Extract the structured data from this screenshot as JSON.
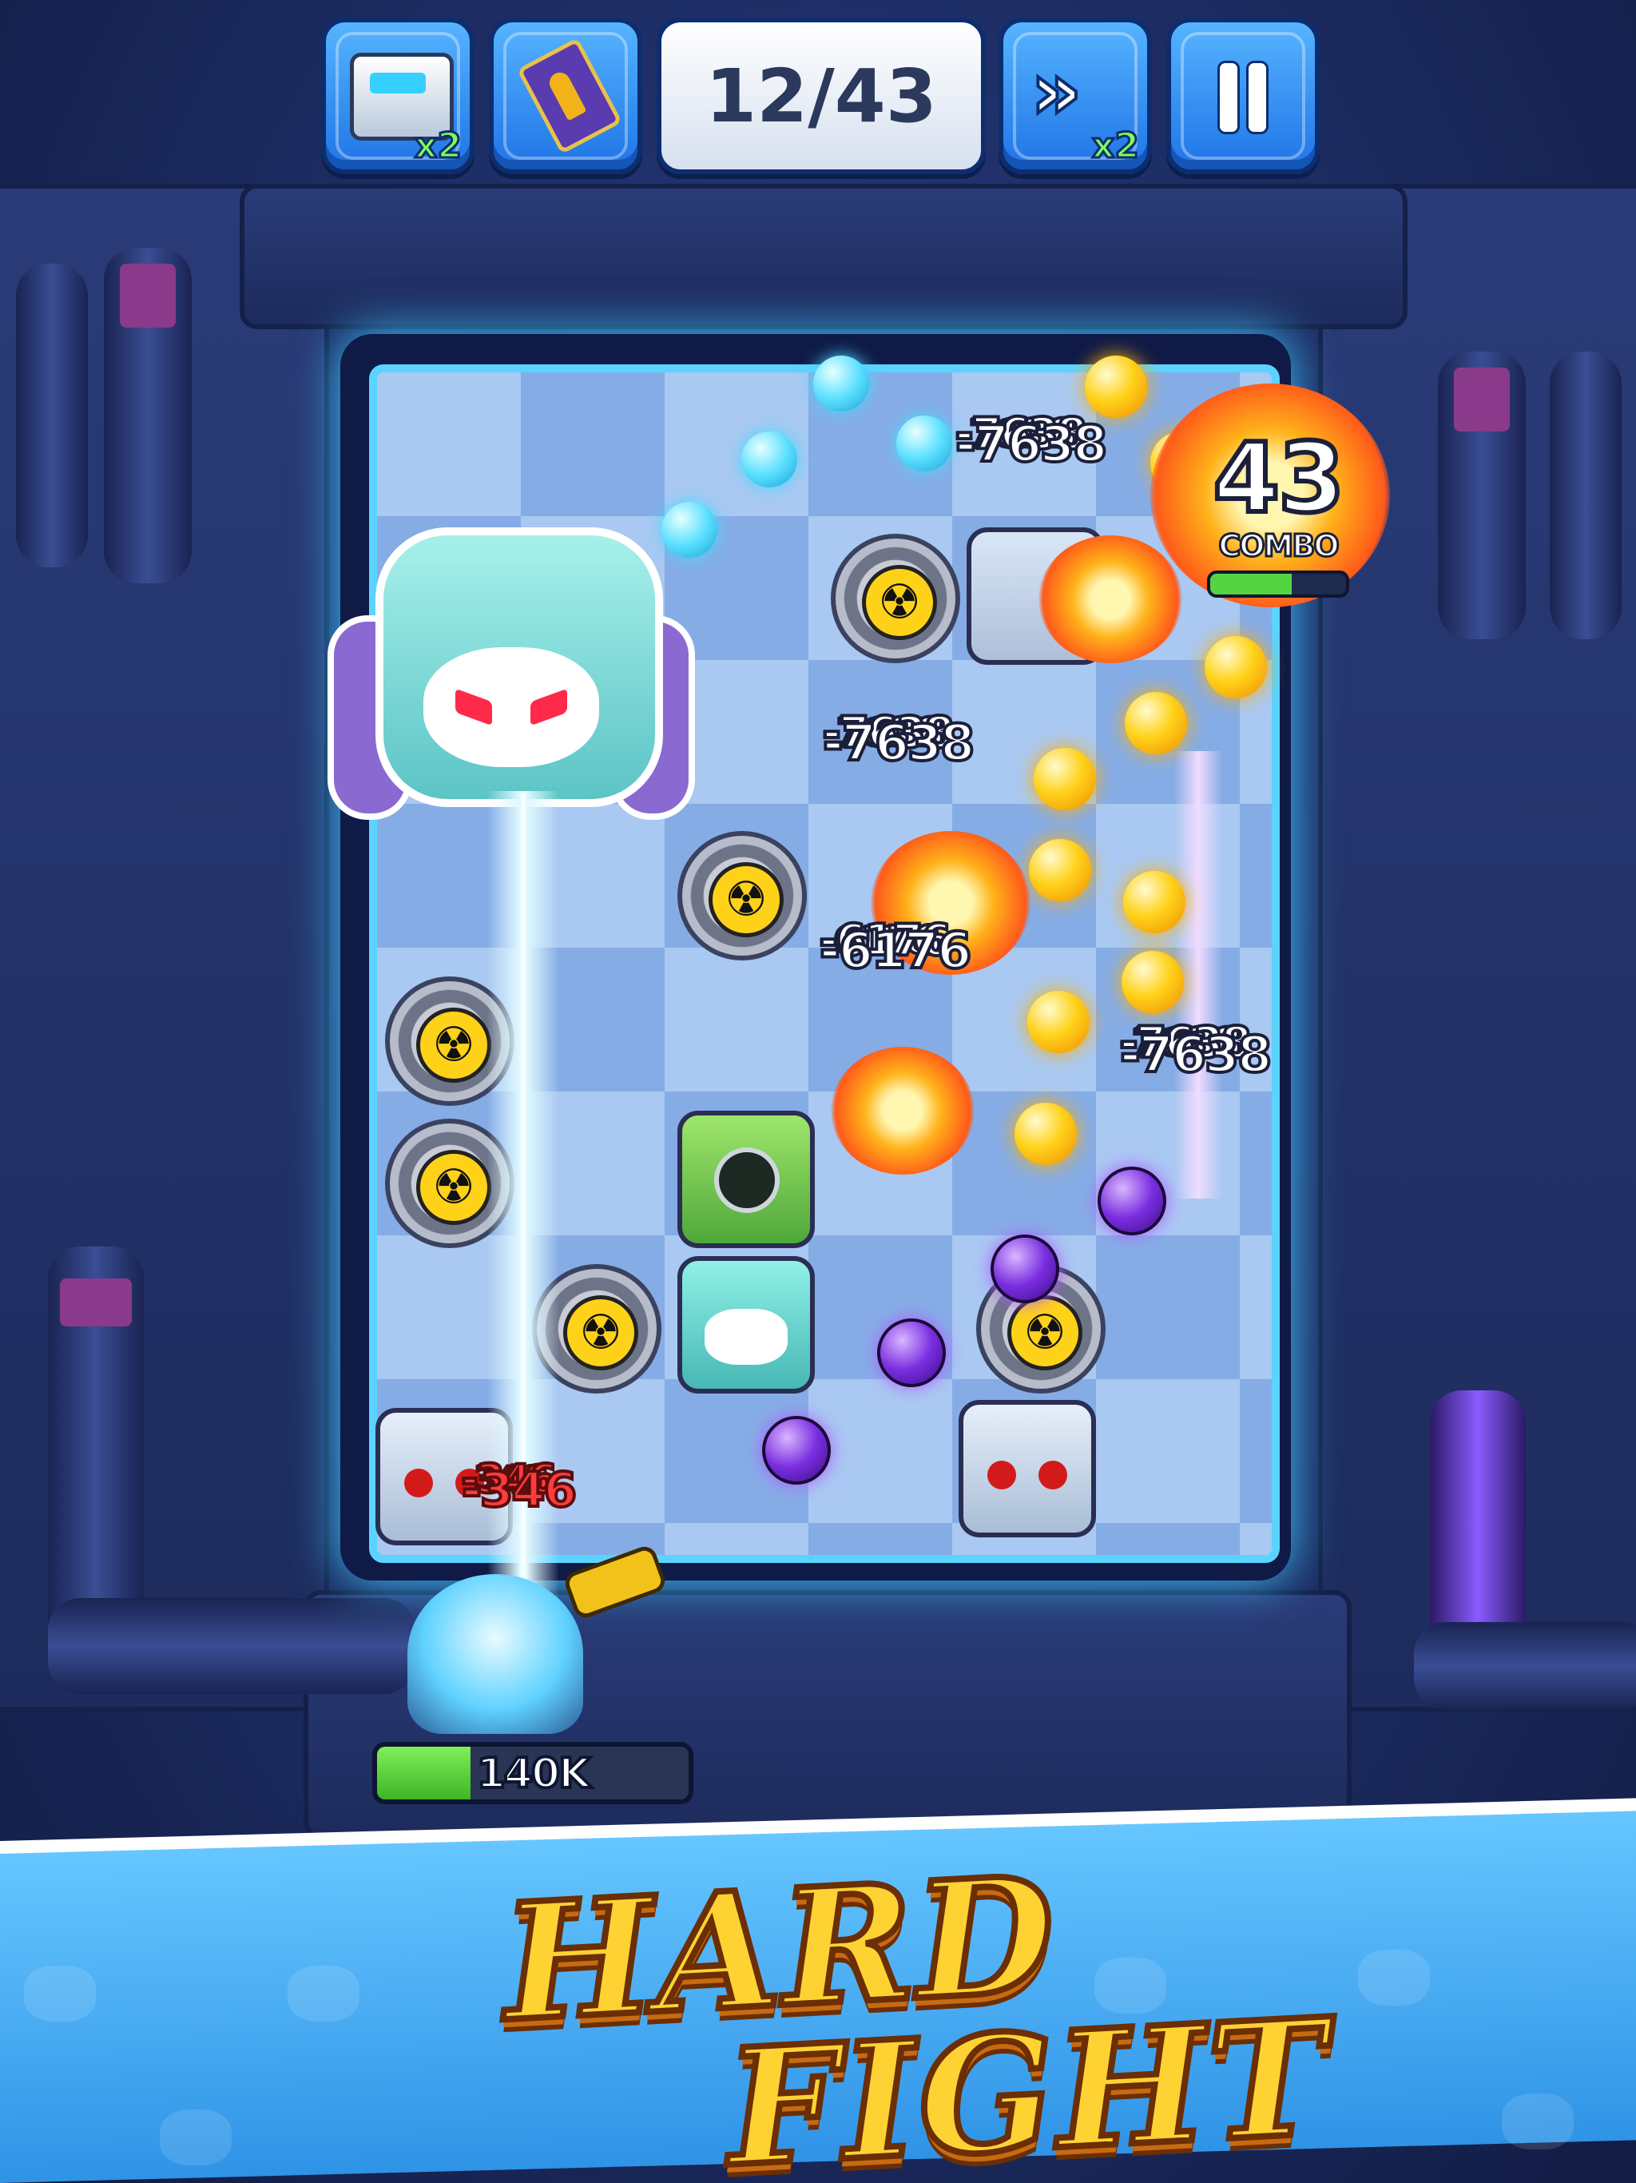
{
  "hud": {
    "chest_multiplier": "x2",
    "wave_counter": "12/43",
    "speed_multiplier": "x2"
  },
  "combo": {
    "count": "43",
    "label": "COMBO",
    "progress_fraction": 0.6
  },
  "damage_numbers": {
    "top_cluster": [
      "-7638",
      "-7638",
      "-7638",
      "-7638"
    ],
    "middle_cluster": [
      "-7638",
      "-7638",
      "-7638",
      "-7638"
    ],
    "lower_cluster": [
      "-6176",
      "-6176",
      "-6176",
      "-6176"
    ],
    "right_cluster": [
      "-7638",
      "-7638",
      "-7638",
      "-7638",
      "-7638"
    ],
    "player_hits": [
      "-346",
      "-346",
      "-346",
      "-346"
    ]
  },
  "player": {
    "health_label": "140K",
    "health_fraction": 0.3
  },
  "slogan": {
    "line1": "HARD",
    "line2": "FIGHT"
  },
  "colors": {
    "hud_button": "#2f8df0",
    "board_border": "#5bd3ff",
    "combo_bar": "#55d442",
    "slogan_fill": "#ffd233",
    "banner": "#4ab0f7"
  }
}
